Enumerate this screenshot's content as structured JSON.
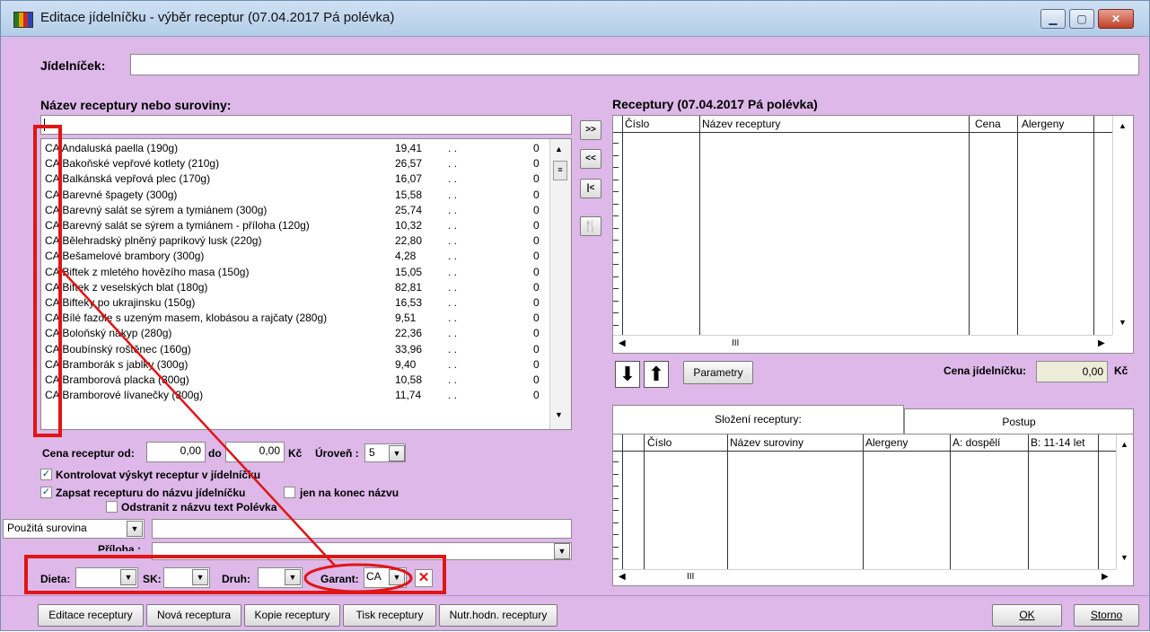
{
  "window": {
    "title": "Editace jídelníčku - výběr receptur (07.04.2017 Pá polévka)",
    "min_icon": "minimize-icon",
    "max_icon": "maximize-icon",
    "close_icon": "close-icon"
  },
  "header": {
    "jidelnicek_label": "Jídelníček:",
    "jidelnicek_value": ""
  },
  "left": {
    "search_label": "Název receptury nebo suroviny:",
    "search_value": "",
    "items": [
      {
        "name": "CA Andaluská paella (190g)",
        "price": "19,41",
        "dots": ". .",
        "count": "0"
      },
      {
        "name": "CA Bakoňské vepřové kotlety (210g)",
        "price": "26,57",
        "dots": ". .",
        "count": "0"
      },
      {
        "name": "CA Balkánská vepřová plec (170g)",
        "price": "16,07",
        "dots": ". .",
        "count": "0"
      },
      {
        "name": "CA Barevné špagety (300g)",
        "price": "15,58",
        "dots": ". .",
        "count": "0"
      },
      {
        "name": "CA Barevný salát se sýrem a tymiánem (300g)",
        "price": "25,74",
        "dots": ". .",
        "count": "0"
      },
      {
        "name": "CA Barevný salát se sýrem a tymiánem - příloha (120g)",
        "price": "10,32",
        "dots": ". .",
        "count": "0"
      },
      {
        "name": "CA Bělehradský plněný paprikový lusk (220g)",
        "price": "22,80",
        "dots": ". .",
        "count": "0"
      },
      {
        "name": "CA Bešamelové brambory (300g)",
        "price": "4,28",
        "dots": ". .",
        "count": "0"
      },
      {
        "name": "CA Biftek z mletého hovězího masa (150g)",
        "price": "15,05",
        "dots": ". .",
        "count": "0"
      },
      {
        "name": "CA Biftek z veselských blat (180g)",
        "price": "82,81",
        "dots": ". .",
        "count": "0"
      },
      {
        "name": "CA Bifteky po ukrajinsku (150g)",
        "price": "16,53",
        "dots": ". .",
        "count": "0"
      },
      {
        "name": "CA Bílé fazole s uzeným masem, klobásou a rajčaty (280g)",
        "price": "9,51",
        "dots": ". .",
        "count": "0"
      },
      {
        "name": "CA Boloňský nákyp (280g)",
        "price": "22,36",
        "dots": ". .",
        "count": "0"
      },
      {
        "name": "CA Boubínský roštěnec (160g)",
        "price": "33,96",
        "dots": ". .",
        "count": "0"
      },
      {
        "name": "CA Bramborák s jablky (300g)",
        "price": "9,40",
        "dots": ". .",
        "count": "0"
      },
      {
        "name": "CA Bramborová placka (300g)",
        "price": "10,58",
        "dots": ". .",
        "count": "0"
      },
      {
        "name": "CA Bramborové lívanečky (300g)",
        "price": "11,74",
        "dots": ". .",
        "count": "0"
      }
    ],
    "cena_od_label": "Cena receptur od:",
    "cena_od_value": "0,00",
    "do_label": "do",
    "cena_do_value": "0,00",
    "kc_label": "Kč",
    "uroven_label": "Úroveň :",
    "uroven_value": "5",
    "chk_kontrolovat": "Kontrolovat výskyt receptur v jídelníčku",
    "chk_zapsat": "Zapsat recepturu do názvu jídelníčku",
    "chk_jen_konec": "jen na konec názvu",
    "chk_odstranit": "Odstranit z názvu text Polévka",
    "surovina_select": "Použitá surovina",
    "surovina_value": "",
    "priloha_label": "Příloha :",
    "priloha_value": "",
    "dieta_label": "Dieta:",
    "sk_label": "SK:",
    "druh_label": "Druh:",
    "garant_label": "Garant:",
    "garant_value": "CA"
  },
  "mid": {
    "add": ">>",
    "remove_all": "<<",
    "first": "|<",
    "cutlery_icon": "cutlery-icon"
  },
  "right": {
    "title": "Receptury (07.04.2017 Pá polévka)",
    "columns": [
      "Číslo",
      "Název receptury",
      "Cena",
      "Alergeny"
    ],
    "hscroll_thumb": "III",
    "parametry": "Parametry",
    "cena_jidelnicku_label": "Cena jídelníčku:",
    "cena_jidelnicku_value": "0,00",
    "kc_label": "Kč",
    "tabs": [
      "Složení receptury:",
      "Postup"
    ],
    "comp_columns": [
      "Číslo",
      "Název suroviny",
      "Alergeny",
      "A: dospělí",
      "B: 11-14 let"
    ]
  },
  "footer": {
    "editace": "Editace receptury",
    "nova": "Nová receptura",
    "kopie": "Kopie receptury",
    "tisk": "Tisk receptury",
    "nutr": "Nutr.hodn. receptury",
    "ok": "OK",
    "storno": "Storno"
  }
}
